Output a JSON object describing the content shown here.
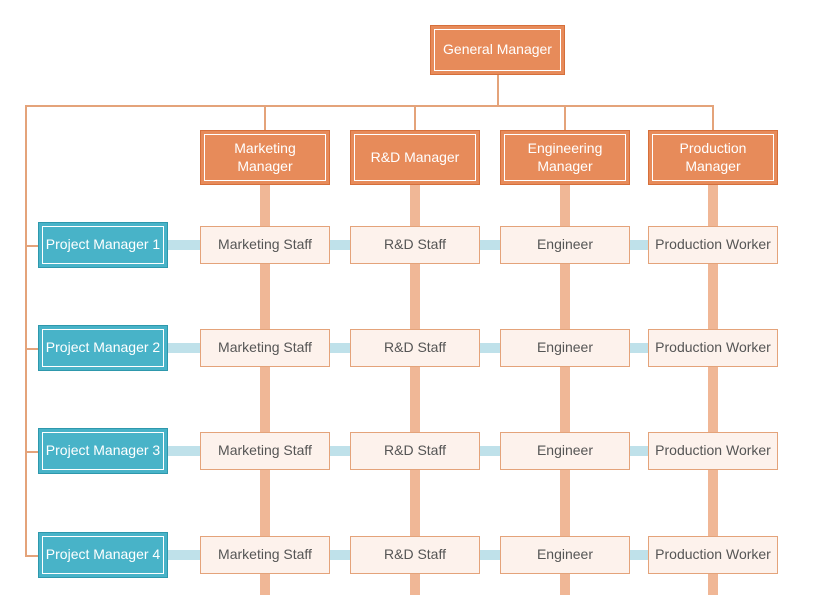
{
  "chart_data": {
    "type": "org-matrix",
    "root": "General Manager",
    "functional_managers": [
      "Marketing Manager",
      "R&D Manager",
      "Engineering Manager",
      "Production Manager"
    ],
    "project_managers": [
      "Project Manager 1",
      "Project Manager 2",
      "Project Manager 3",
      "Project Manager 4"
    ],
    "cells": [
      [
        "Marketing Staff",
        "R&D Staff",
        "Engineer",
        "Production Worker"
      ],
      [
        "Marketing Staff",
        "R&D Staff",
        "Engineer",
        "Production Worker"
      ],
      [
        "Marketing Staff",
        "R&D Staff",
        "Engineer",
        "Production Worker"
      ],
      [
        "Marketing Staff",
        "R&D Staff",
        "Engineer",
        "Production Worker"
      ]
    ]
  },
  "top": {
    "label": "General Manager"
  },
  "fm": [
    {
      "label": "Marketing Manager"
    },
    {
      "label": "R&D Manager"
    },
    {
      "label": "Engineering Manager"
    },
    {
      "label": "Production Manager"
    }
  ],
  "pm": [
    {
      "label": "Project Manager 1"
    },
    {
      "label": "Project Manager 2"
    },
    {
      "label": "Project Manager 3"
    },
    {
      "label": "Project Manager 4"
    }
  ],
  "row": [
    {
      "c": [
        "Marketing Staff",
        "R&D Staff",
        "Engineer",
        "Production Worker"
      ]
    },
    {
      "c": [
        "Marketing Staff",
        "R&D Staff",
        "Engineer",
        "Production Worker"
      ]
    },
    {
      "c": [
        "Marketing Staff",
        "R&D Staff",
        "Engineer",
        "Production Worker"
      ]
    },
    {
      "c": [
        "Marketing Staff",
        "R&D Staff",
        "Engineer",
        "Production Worker"
      ]
    }
  ]
}
